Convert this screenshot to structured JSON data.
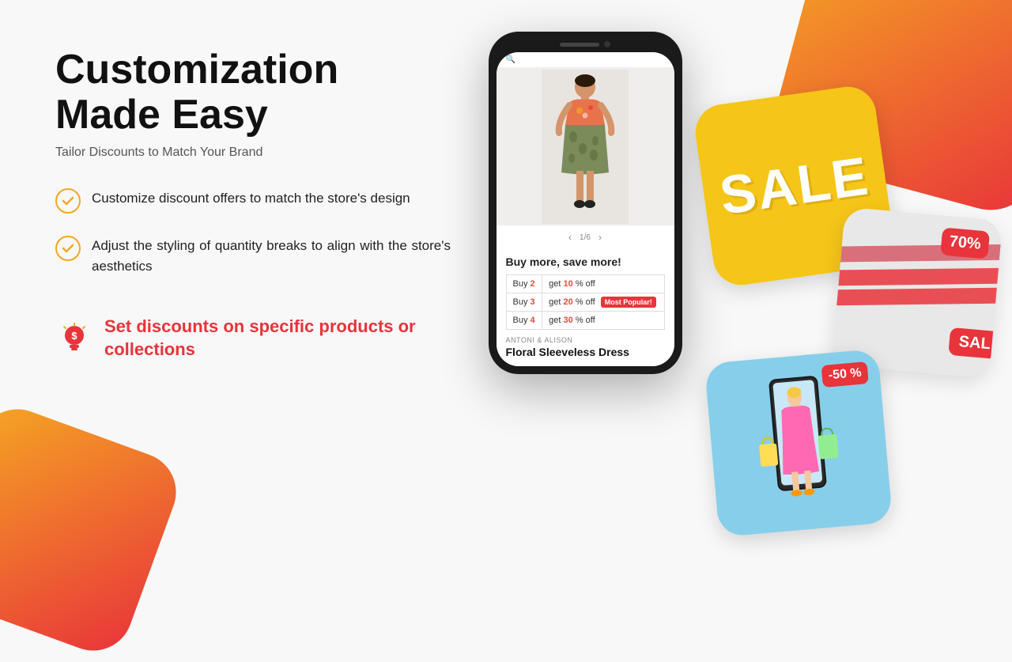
{
  "page": {
    "title": "Customization Made Easy",
    "subtitle": "Tailor Discounts to Match Your Brand",
    "features": [
      {
        "id": "feature-1",
        "text": "Customize discount offers to match the store's design"
      },
      {
        "id": "feature-2",
        "text": "Adjust the styling of quantity breaks to align with the store's aesthetics"
      }
    ],
    "highlight": {
      "text": "Set discounts on specific products or collections"
    },
    "phone": {
      "buy_more_title": "Buy more, save more!",
      "nav_counter": "1/6",
      "rows": [
        {
          "qty_label": "Buy ",
          "qty_num": "2",
          "discount_prefix": "get ",
          "discount_pct": "10",
          "discount_suffix": " % off",
          "badge": ""
        },
        {
          "qty_label": "Buy ",
          "qty_num": "3",
          "discount_prefix": "get ",
          "discount_pct": "20",
          "discount_suffix": " % off",
          "badge": "Most Popular!"
        },
        {
          "qty_label": "Buy ",
          "qty_num": "4",
          "discount_prefix": "get ",
          "discount_pct": "30",
          "discount_suffix": " % off",
          "badge": ""
        }
      ],
      "product_brand": "Antoni & Alison",
      "product_name": "Floral Sleeveless Dress"
    },
    "cards": {
      "card1_text": "SALE",
      "card2_badge": "70%",
      "card2_sal": "SAL",
      "card3_badge": "-50 %"
    }
  }
}
